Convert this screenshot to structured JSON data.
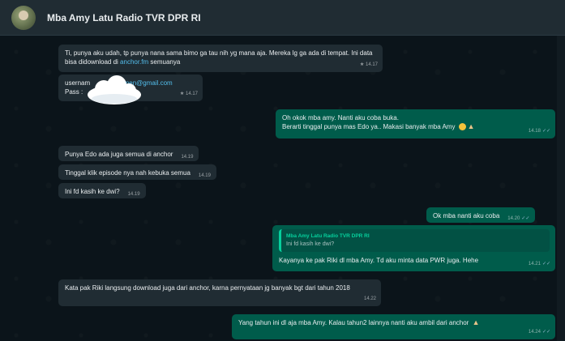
{
  "header": {
    "title": "Mba Amy Latu Radio TVR DPR RI"
  },
  "messages": {
    "m1": {
      "text": "Ti, punya aku udah, tp punya nana sama bimo ga tau nih yg mana aja. Mereka lg ga ada di tempat. Ini data bisa didownload di ",
      "link": "anchor.fm",
      "text_after": " semuanya",
      "time": "14.17",
      "star": "★"
    },
    "m2": {
      "user_label": "usernam",
      "user_tail": "emen@gmail.com",
      "pass_label": "Pass :",
      "time": "14.17",
      "star": "★"
    },
    "m3": {
      "line1": "Oh okok mba amy. Nanti aku coba buka.",
      "line2": "Berarti tinggal punya mas Edo ya.. Makasi banyak mba Amy",
      "time": "14.18",
      "tick": "✓✓"
    },
    "m4": {
      "text": "Punya Edo ada juga semua di anchor",
      "time": "14.19"
    },
    "m5": {
      "text": "Tinggal klik episode nya nah kebuka semua",
      "time": "14.19"
    },
    "m6": {
      "text": "Ini fd kasih ke dwi?",
      "time": "14.19"
    },
    "m7": {
      "text": "Ok mba nanti aku coba",
      "time": "14.20",
      "tick": "✓✓"
    },
    "m8": {
      "quote_name": "Mba Amy Latu Radio TVR DPR RI",
      "quote_text": "Ini fd kasih ke dwi?",
      "text": "Kayanya ke pak Riki dl mba Amy. Td aku minta data PWR juga. Hehe",
      "time": "14.21",
      "tick": "✓✓"
    },
    "m9": {
      "text": "Kata pak Riki langsung download juga dari anchor, karna pernyataan jg banyak bgt dari tahun 2018",
      "time": "14.22"
    },
    "m10": {
      "text": "Yang tahun ini dl aja mba Amy. Kalau tahun2 lainnya nanti aku ambil dari anchor",
      "time": "14.24",
      "tick": "✓✓"
    }
  },
  "colors": {
    "background": "#0b141a",
    "incoming": "#202c33",
    "outgoing": "#005c4b",
    "accent": "#06cf9c",
    "link": "#53bdeb"
  },
  "icons": [
    "avatar",
    "cloud-sticker",
    "smile-emoji-icon",
    "pray-emoji-icon",
    "double-check-icon",
    "star-icon"
  ]
}
